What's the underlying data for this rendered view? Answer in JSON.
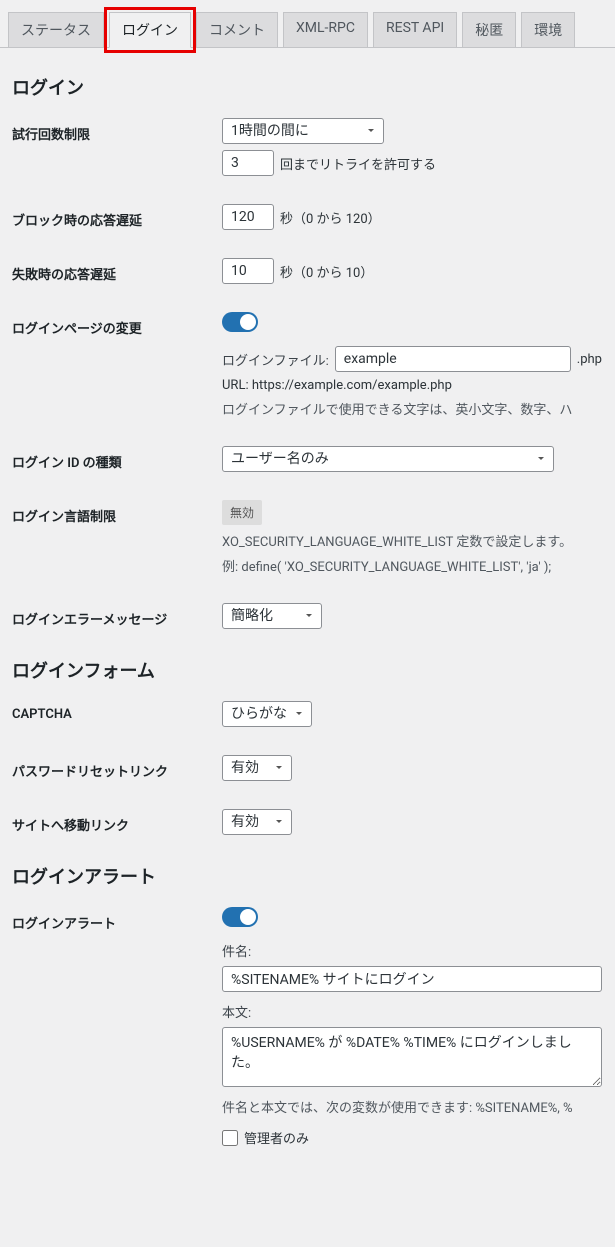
{
  "tabs": {
    "status": "ステータス",
    "login": "ログイン",
    "comment": "コメント",
    "xmlrpc": "XML-RPC",
    "restapi": "REST API",
    "secret": "秘匿",
    "env": "環境"
  },
  "sections": {
    "login_header": "ログイン",
    "login_form_header": "ログインフォーム",
    "login_alert_header": "ログインアラート"
  },
  "fields": {
    "attempt_limit": {
      "label": "試行回数制限",
      "period_value": "1時間の間に",
      "count_value": "3",
      "suffix": "回までリトライを許可する"
    },
    "block_delay": {
      "label": "ブロック時の応答遅延",
      "value": "120",
      "suffix": "秒（0 から 120）"
    },
    "fail_delay": {
      "label": "失敗時の応答遅延",
      "value": "10",
      "suffix": "秒（0 から 10）"
    },
    "login_page": {
      "label": "ログインページの変更",
      "file_label": "ログインファイル:",
      "file_value": "example",
      "file_ext": ".php",
      "url_text": "URL: https://example.com/example.php",
      "desc": "ログインファイルで使用できる文字は、英小文字、数字、ハ"
    },
    "login_id_type": {
      "label": "ログイン ID の種類",
      "value": "ユーザー名のみ"
    },
    "login_lang": {
      "label": "ログイン言語制限",
      "badge": "無効",
      "desc1": "XO_SECURITY_LANGUAGE_WHITE_LIST 定数で設定します。",
      "desc2": "例: define( 'XO_SECURITY_LANGUAGE_WHITE_LIST', 'ja' );"
    },
    "login_error": {
      "label": "ログインエラーメッセージ",
      "value": "簡略化"
    },
    "captcha": {
      "label": "CAPTCHA",
      "value": "ひらがな"
    },
    "pwreset_link": {
      "label": "パスワードリセットリンク",
      "value": "有効"
    },
    "site_link": {
      "label": "サイトへ移動リンク",
      "value": "有効"
    },
    "login_alert": {
      "label": "ログインアラート",
      "subject_label": "件名:",
      "subject_value": "%SITENAME% サイトにログイン",
      "body_label": "本文:",
      "body_value": "%USERNAME% が %DATE% %TIME% にログインしました。",
      "desc": "件名と本文では、次の変数が使用できます: %SITENAME%, %",
      "admin_only": "管理者のみ"
    }
  }
}
